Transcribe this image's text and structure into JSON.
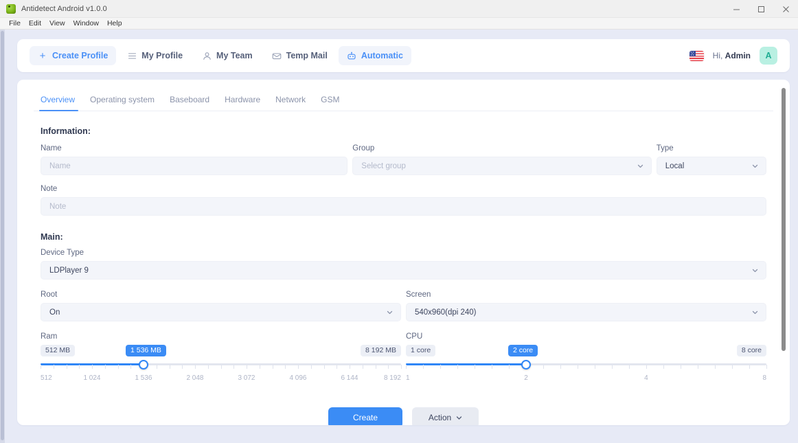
{
  "window": {
    "title": "Antidetect Android v1.0.0",
    "app_icon": "android-robot-icon",
    "controls": {
      "minimize": "minimize-icon",
      "maximize": "maximize-icon",
      "close": "close-icon"
    },
    "menu": [
      "File",
      "Edit",
      "View",
      "Window",
      "Help"
    ]
  },
  "topnav": {
    "items": [
      {
        "label": "Create Profile",
        "icon": "plus-icon",
        "state": "soft-active"
      },
      {
        "label": "My Profile",
        "icon": "list-icon",
        "state": "default"
      },
      {
        "label": "My Team",
        "icon": "user-icon",
        "state": "default"
      },
      {
        "label": "Temp Mail",
        "icon": "mail-icon",
        "state": "default"
      },
      {
        "label": "Automatic",
        "icon": "robot-icon",
        "state": "active"
      }
    ],
    "flag": "us-flag-icon",
    "greeting": "Hi, ",
    "user_name": "Admin",
    "avatar_initial": "A"
  },
  "tabs": [
    {
      "label": "Overview",
      "active": true
    },
    {
      "label": "Operating system",
      "active": false
    },
    {
      "label": "Baseboard",
      "active": false
    },
    {
      "label": "Hardware",
      "active": false
    },
    {
      "label": "Network",
      "active": false
    },
    {
      "label": "GSM",
      "active": false
    }
  ],
  "information": {
    "heading": "Information:",
    "name": {
      "label": "Name",
      "value": "",
      "placeholder": "Name"
    },
    "group": {
      "label": "Group",
      "value": "",
      "placeholder": "Select group"
    },
    "type": {
      "label": "Type",
      "value": "Local"
    },
    "note": {
      "label": "Note",
      "value": "",
      "placeholder": "Note"
    }
  },
  "main": {
    "heading": "Main:",
    "device_type": {
      "label": "Device Type",
      "value": "LDPlayer 9"
    },
    "root": {
      "label": "Root",
      "value": "On"
    },
    "screen": {
      "label": "Screen",
      "value": "540x960(dpi 240)"
    },
    "ram": {
      "label": "Ram",
      "min_badge": "512 MB",
      "value_badge": "1 536 MB",
      "max_badge": "8 192 MB",
      "ticks": [
        "512",
        "1 024",
        "1 536",
        "2 048",
        "3 072",
        "4 096",
        "6 144",
        "8 192"
      ],
      "tick_positions": [
        0,
        14.28,
        28.57,
        42.85,
        57.14,
        71.42,
        85.71,
        100
      ],
      "fill_percent": 28.57
    },
    "cpu": {
      "label": "CPU",
      "min_badge": "1 core",
      "value_badge": "2 core",
      "max_badge": "8 core",
      "ticks": [
        "1",
        "2",
        "4",
        "8"
      ],
      "tick_positions": [
        0,
        33.33,
        66.66,
        100
      ],
      "minor_tick_positions": [
        0,
        4.76,
        9.52,
        14.28,
        19.04,
        23.8,
        28.57,
        33.33,
        38.09,
        42.85,
        47.61,
        52.38,
        57.14,
        61.9,
        66.66,
        71.42,
        76.19,
        80.95,
        85.71,
        90.47,
        95.23,
        100
      ],
      "fill_percent": 33.33
    }
  },
  "actions": {
    "create": "Create",
    "action": "Action",
    "action_chevron": "chevron-down-icon"
  },
  "colors": {
    "accent": "#3b8cf5",
    "tab_active": "#4a90f7",
    "page_bg": "#e7eaf6",
    "field_bg": "#f3f5fa",
    "avatar_bg": "#b9f0e2",
    "avatar_fg": "#1fae93"
  }
}
